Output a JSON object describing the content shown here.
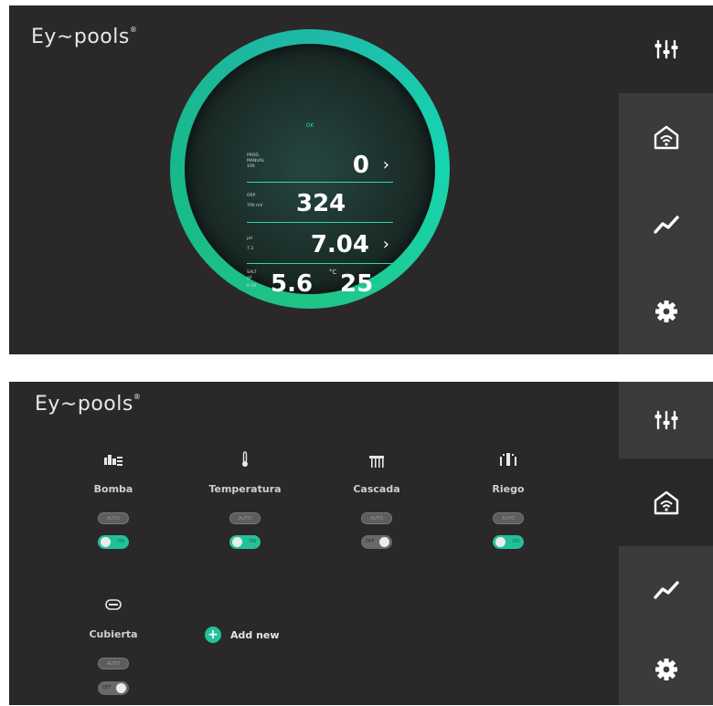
{
  "app": {
    "logo": "Ey∼pools",
    "logo_mark": "®"
  },
  "dashboard": {
    "status": "OK",
    "rows": [
      {
        "label_lines": [
          "PROD.",
          "MANUAL",
          "100"
        ],
        "value": "0",
        "chevron": "›"
      },
      {
        "label_lines": [
          "ORP",
          "700 mV"
        ],
        "value": "324",
        "chevron": ""
      },
      {
        "label_lines": [
          "pH",
          "7.3"
        ],
        "value": "7.04",
        "chevron": "›"
      },
      {
        "label_lines": [
          "SALT",
          "g/l",
          "0-10"
        ],
        "value": "5.6",
        "extra_unit": "°C",
        "extra_value": "25"
      }
    ]
  },
  "sidebar": {
    "items": [
      {
        "icon": "sliders-icon"
      },
      {
        "icon": "home-wifi-icon"
      },
      {
        "icon": "chart-icon"
      },
      {
        "icon": "gear-icon"
      }
    ]
  },
  "devices": [
    {
      "name": "Bomba",
      "icon": "pump-icon",
      "mode": "AUTO",
      "state": "ON"
    },
    {
      "name": "Temperatura",
      "icon": "thermometer-icon",
      "mode": "AUTO",
      "state": "ON"
    },
    {
      "name": "Cascada",
      "icon": "waterfall-icon",
      "mode": "AUTO",
      "state": "OFF"
    },
    {
      "name": "Riego",
      "icon": "sprinkler-icon",
      "mode": "AUTO",
      "state": "ON"
    },
    {
      "name": "Cubierta",
      "icon": "pool-cover-icon",
      "mode": "AUTO",
      "state": "OFF"
    }
  ],
  "add_new": {
    "label": "Add new",
    "icon": "+"
  },
  "colors": {
    "accent": "#23c19a",
    "panel": "#2b2829",
    "sidebar_active": "#3a3839"
  }
}
